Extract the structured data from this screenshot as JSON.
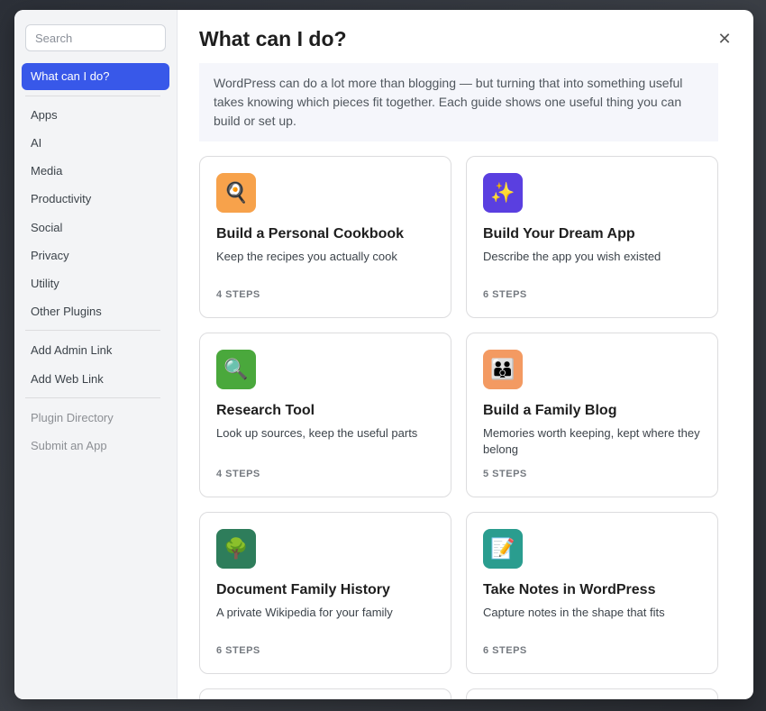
{
  "sidebar": {
    "search_placeholder": "Search",
    "active_item": "What can I do?",
    "categories": [
      "Apps",
      "AI",
      "Media",
      "Productivity",
      "Social",
      "Privacy",
      "Utility",
      "Other Plugins"
    ],
    "links": [
      "Add Admin Link",
      "Add Web Link"
    ],
    "footer_links": [
      "Plugin Directory",
      "Submit an App"
    ]
  },
  "main": {
    "title": "What can I do?",
    "close_icon": "close-icon",
    "intro": "WordPress can do a lot more than blogging — but turning that into something useful takes knowing which pieces fit together. Each guide shows one useful thing you can build or set up.",
    "guides": [
      {
        "title": "Build a Personal Cookbook",
        "description": "Keep the recipes you actually cook",
        "steps": "4 STEPS",
        "icon": "cookbook-icon",
        "glyph": "🍳",
        "color": "#f7a24b"
      },
      {
        "title": "Build Your Dream App",
        "description": "Describe the app you wish existed",
        "steps": "6 STEPS",
        "icon": "sparkles-icon",
        "glyph": "✨",
        "color": "#5a3fe0"
      },
      {
        "title": "Research Tool",
        "description": "Look up sources, keep the useful parts",
        "steps": "4 STEPS",
        "icon": "magnifier-icon",
        "glyph": "🔍",
        "color": "#4aa83c"
      },
      {
        "title": "Build a Family Blog",
        "description": "Memories worth keeping, kept where they belong",
        "steps": "5 STEPS",
        "icon": "family-icon",
        "glyph": "👪",
        "color": "#f39a62"
      },
      {
        "title": "Document Family History",
        "description": "A private Wikipedia for your family",
        "steps": "6 STEPS",
        "icon": "tree-icon",
        "glyph": "🌳",
        "color": "#2e7d5b"
      },
      {
        "title": "Take Notes in WordPress",
        "description": "Capture notes in the shape that fits",
        "steps": "6 STEPS",
        "icon": "notepad-icon",
        "glyph": "📝",
        "color": "#2a9d8f"
      }
    ]
  },
  "colors": {
    "accent": "#3858e9"
  }
}
